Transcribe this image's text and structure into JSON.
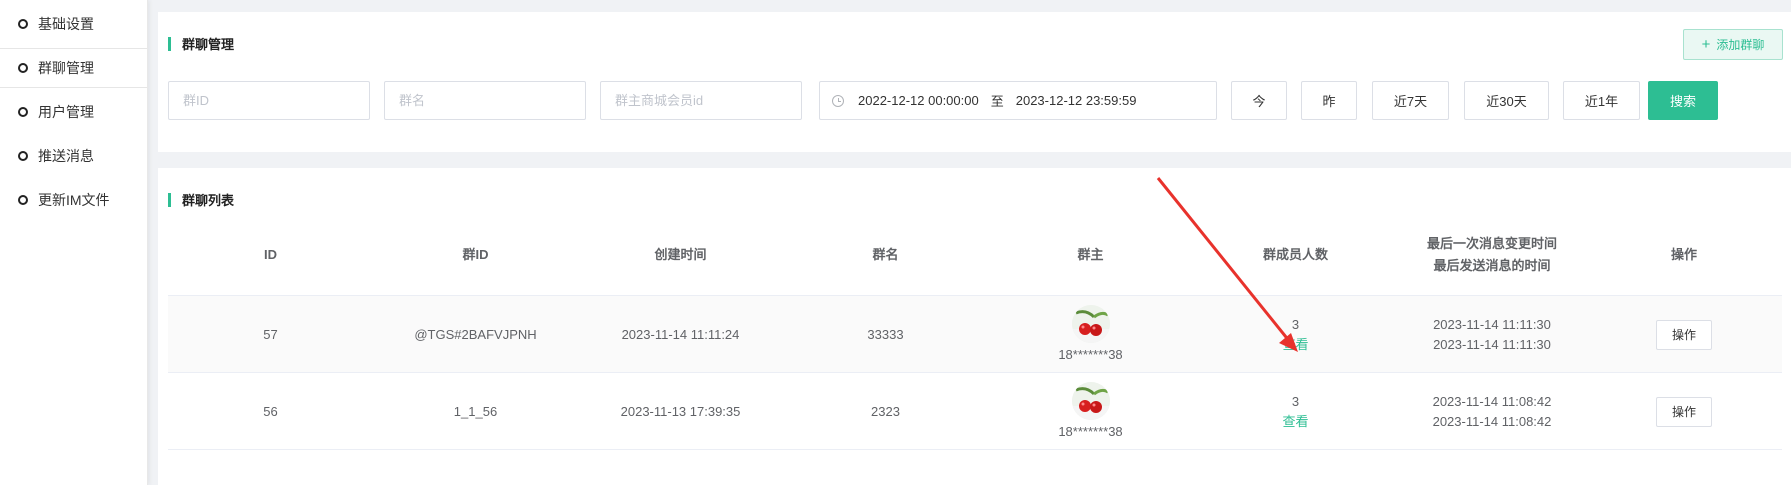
{
  "sidebar": {
    "items": [
      {
        "label": "基础设置"
      },
      {
        "label": "群聊管理"
      },
      {
        "label": "用户管理"
      },
      {
        "label": "推送消息"
      },
      {
        "label": "更新IM文件"
      }
    ]
  },
  "search_panel": {
    "title": "群聊管理",
    "add_button": "添加群聊",
    "group_id_placeholder": "群ID",
    "group_name_placeholder": "群名",
    "owner_id_placeholder": "群主商城会员id",
    "date_start": "2022-12-12 00:00:00",
    "date_separator": "至",
    "date_end": "2023-12-12 23:59:59",
    "quick_buttons": [
      "今",
      "昨",
      "近7天",
      "近30天",
      "近1年"
    ],
    "search_button": "搜索"
  },
  "list_panel": {
    "title": "群聊列表",
    "headers": {
      "id": "ID",
      "group_id": "群ID",
      "created": "创建时间",
      "name": "群名",
      "owner": "群主",
      "members": "群成员人数",
      "last_change": "最后一次消息变更时间",
      "last_send": "最后发送消息的时间",
      "op": "操作"
    },
    "rows": [
      {
        "id": "57",
        "group_id": "@TGS#2BAFVJPNH",
        "created": "2023-11-14 11:11:24",
        "name": "33333",
        "owner": "18*******38",
        "members": "3",
        "view": "查看",
        "last_change": "2023-11-14 11:11:30",
        "last_send": "2023-11-14 11:11:30",
        "op": "操作"
      },
      {
        "id": "56",
        "group_id": "1_1_56",
        "created": "2023-11-13 17:39:35",
        "name": "2323",
        "owner": "18*******38",
        "members": "3",
        "view": "查看",
        "last_change": "2023-11-14 11:08:42",
        "last_send": "2023-11-14 11:08:42",
        "op": "操作"
      }
    ]
  },
  "colors": {
    "accent": "#2dbe93",
    "annotation_arrow": "#e8322c"
  }
}
